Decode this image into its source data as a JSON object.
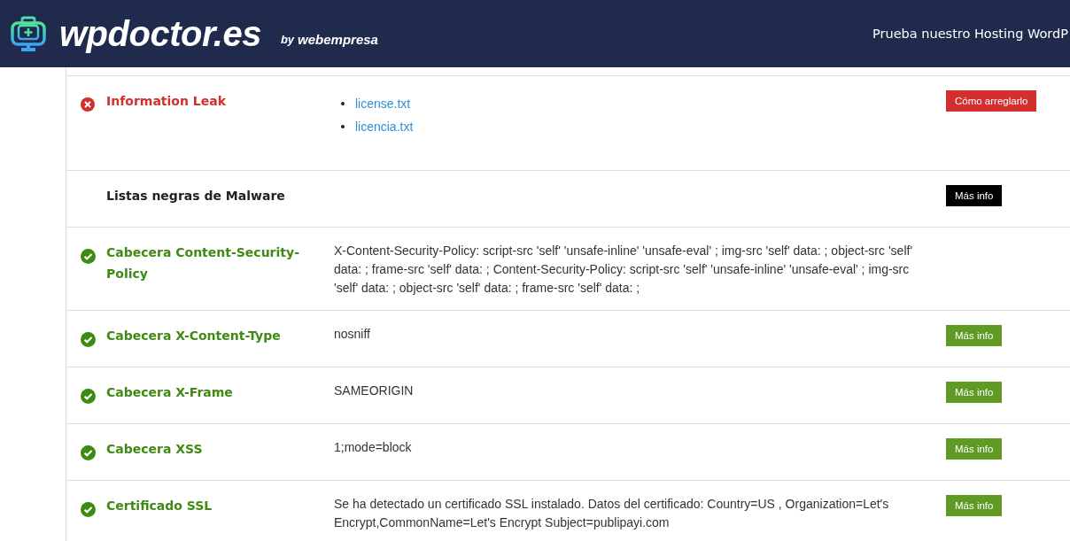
{
  "header": {
    "logo": "wpdoctor.es",
    "by": "by",
    "brand": "webempresa",
    "cta": "Prueba nuestro Hosting WordP"
  },
  "checks": [
    {
      "kind": "error",
      "label": "Information Leak",
      "bullet": "•",
      "links": [
        "license.txt",
        "licencia.txt"
      ],
      "button": "Cómo arreglarlo"
    },
    {
      "kind": "plain",
      "label": "Listas negras de Malware",
      "button": "Más info"
    },
    {
      "kind": "ok",
      "label": "Cabecera Content-Security-Policy",
      "value": "X-Content-Security-Policy: script-src 'self' 'unsafe-inline' 'unsafe-eval' ; img-src 'self' data: ; object-src 'self' data: ; frame-src 'self' data: ; Content-Security-Policy: script-src 'self' 'unsafe-inline' 'unsafe-eval' ; img-src 'self' data: ; object-src 'self' data: ; frame-src 'self' data: ;"
    },
    {
      "kind": "ok",
      "label": "Cabecera X-Content-Type",
      "value": "nosniff",
      "button": "Más info"
    },
    {
      "kind": "ok",
      "label": "Cabecera X-Frame",
      "value": "SAMEORIGIN",
      "button": "Más info"
    },
    {
      "kind": "ok",
      "label": "Cabecera XSS",
      "value": "1;mode=block",
      "button": "Más info"
    },
    {
      "kind": "ok",
      "label": "Certificado SSL",
      "value": "Se ha detectado un certificado SSL instalado. Datos del certificado: Country=US , Organization=Let's Encrypt,CommonName=Let's Encrypt Subject=publipayi.com",
      "button": "Más info"
    }
  ]
}
